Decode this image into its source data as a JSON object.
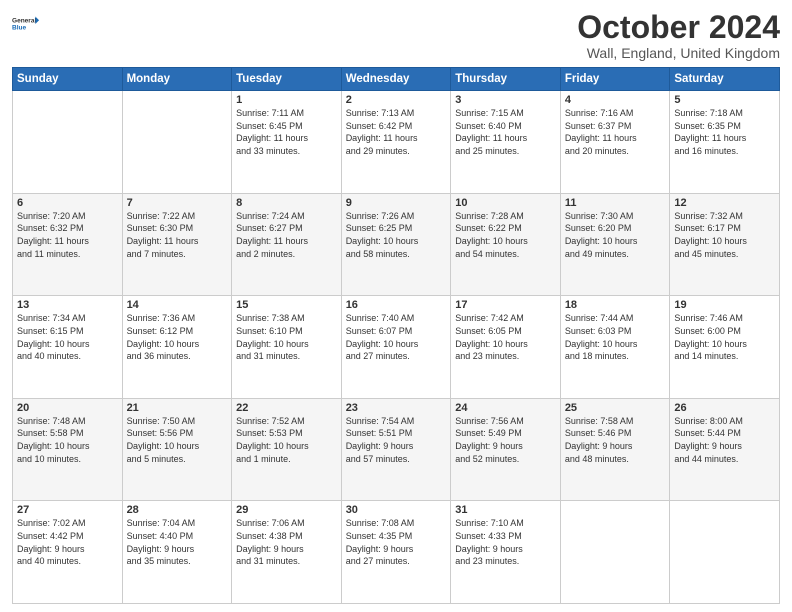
{
  "header": {
    "logo_line1": "General",
    "logo_line2": "Blue",
    "month_title": "October 2024",
    "location": "Wall, England, United Kingdom"
  },
  "days_of_week": [
    "Sunday",
    "Monday",
    "Tuesday",
    "Wednesday",
    "Thursday",
    "Friday",
    "Saturday"
  ],
  "weeks": [
    [
      {
        "day": "",
        "info": ""
      },
      {
        "day": "",
        "info": ""
      },
      {
        "day": "1",
        "info": "Sunrise: 7:11 AM\nSunset: 6:45 PM\nDaylight: 11 hours\nand 33 minutes."
      },
      {
        "day": "2",
        "info": "Sunrise: 7:13 AM\nSunset: 6:42 PM\nDaylight: 11 hours\nand 29 minutes."
      },
      {
        "day": "3",
        "info": "Sunrise: 7:15 AM\nSunset: 6:40 PM\nDaylight: 11 hours\nand 25 minutes."
      },
      {
        "day": "4",
        "info": "Sunrise: 7:16 AM\nSunset: 6:37 PM\nDaylight: 11 hours\nand 20 minutes."
      },
      {
        "day": "5",
        "info": "Sunrise: 7:18 AM\nSunset: 6:35 PM\nDaylight: 11 hours\nand 16 minutes."
      }
    ],
    [
      {
        "day": "6",
        "info": "Sunrise: 7:20 AM\nSunset: 6:32 PM\nDaylight: 11 hours\nand 11 minutes."
      },
      {
        "day": "7",
        "info": "Sunrise: 7:22 AM\nSunset: 6:30 PM\nDaylight: 11 hours\nand 7 minutes."
      },
      {
        "day": "8",
        "info": "Sunrise: 7:24 AM\nSunset: 6:27 PM\nDaylight: 11 hours\nand 2 minutes."
      },
      {
        "day": "9",
        "info": "Sunrise: 7:26 AM\nSunset: 6:25 PM\nDaylight: 10 hours\nand 58 minutes."
      },
      {
        "day": "10",
        "info": "Sunrise: 7:28 AM\nSunset: 6:22 PM\nDaylight: 10 hours\nand 54 minutes."
      },
      {
        "day": "11",
        "info": "Sunrise: 7:30 AM\nSunset: 6:20 PM\nDaylight: 10 hours\nand 49 minutes."
      },
      {
        "day": "12",
        "info": "Sunrise: 7:32 AM\nSunset: 6:17 PM\nDaylight: 10 hours\nand 45 minutes."
      }
    ],
    [
      {
        "day": "13",
        "info": "Sunrise: 7:34 AM\nSunset: 6:15 PM\nDaylight: 10 hours\nand 40 minutes."
      },
      {
        "day": "14",
        "info": "Sunrise: 7:36 AM\nSunset: 6:12 PM\nDaylight: 10 hours\nand 36 minutes."
      },
      {
        "day": "15",
        "info": "Sunrise: 7:38 AM\nSunset: 6:10 PM\nDaylight: 10 hours\nand 31 minutes."
      },
      {
        "day": "16",
        "info": "Sunrise: 7:40 AM\nSunset: 6:07 PM\nDaylight: 10 hours\nand 27 minutes."
      },
      {
        "day": "17",
        "info": "Sunrise: 7:42 AM\nSunset: 6:05 PM\nDaylight: 10 hours\nand 23 minutes."
      },
      {
        "day": "18",
        "info": "Sunrise: 7:44 AM\nSunset: 6:03 PM\nDaylight: 10 hours\nand 18 minutes."
      },
      {
        "day": "19",
        "info": "Sunrise: 7:46 AM\nSunset: 6:00 PM\nDaylight: 10 hours\nand 14 minutes."
      }
    ],
    [
      {
        "day": "20",
        "info": "Sunrise: 7:48 AM\nSunset: 5:58 PM\nDaylight: 10 hours\nand 10 minutes."
      },
      {
        "day": "21",
        "info": "Sunrise: 7:50 AM\nSunset: 5:56 PM\nDaylight: 10 hours\nand 5 minutes."
      },
      {
        "day": "22",
        "info": "Sunrise: 7:52 AM\nSunset: 5:53 PM\nDaylight: 10 hours\nand 1 minute."
      },
      {
        "day": "23",
        "info": "Sunrise: 7:54 AM\nSunset: 5:51 PM\nDaylight: 9 hours\nand 57 minutes."
      },
      {
        "day": "24",
        "info": "Sunrise: 7:56 AM\nSunset: 5:49 PM\nDaylight: 9 hours\nand 52 minutes."
      },
      {
        "day": "25",
        "info": "Sunrise: 7:58 AM\nSunset: 5:46 PM\nDaylight: 9 hours\nand 48 minutes."
      },
      {
        "day": "26",
        "info": "Sunrise: 8:00 AM\nSunset: 5:44 PM\nDaylight: 9 hours\nand 44 minutes."
      }
    ],
    [
      {
        "day": "27",
        "info": "Sunrise: 7:02 AM\nSunset: 4:42 PM\nDaylight: 9 hours\nand 40 minutes."
      },
      {
        "day": "28",
        "info": "Sunrise: 7:04 AM\nSunset: 4:40 PM\nDaylight: 9 hours\nand 35 minutes."
      },
      {
        "day": "29",
        "info": "Sunrise: 7:06 AM\nSunset: 4:38 PM\nDaylight: 9 hours\nand 31 minutes."
      },
      {
        "day": "30",
        "info": "Sunrise: 7:08 AM\nSunset: 4:35 PM\nDaylight: 9 hours\nand 27 minutes."
      },
      {
        "day": "31",
        "info": "Sunrise: 7:10 AM\nSunset: 4:33 PM\nDaylight: 9 hours\nand 23 minutes."
      },
      {
        "day": "",
        "info": ""
      },
      {
        "day": "",
        "info": ""
      }
    ]
  ]
}
